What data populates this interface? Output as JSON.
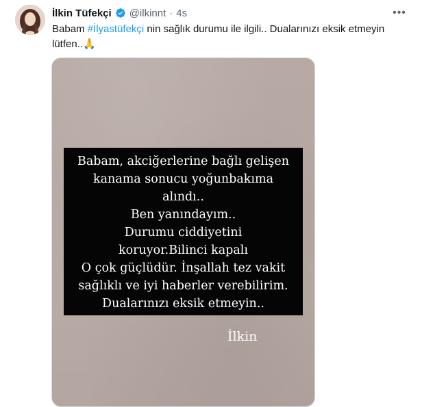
{
  "tweet": {
    "author_name": "İlkin Tüfekçi",
    "handle": "@ilkinnt",
    "separator": "·",
    "time": "4s",
    "more_label": "•••",
    "text_before_hashtag": "Babam ",
    "hashtag": "#İlyastüfekçi",
    "text_after_hashtag": " nin sağlık durumu ile ilgili.. Dualarınızı eksik etmeyin lütfen..🙏"
  },
  "media": {
    "story_lines": [
      "Babam, akciğerlerine bağlı gelişen",
      "kanama sonucu yoğunbakıma",
      "alındı..",
      "Ben yanındayım..",
      "Durumu ciddiyetini",
      "koruyor.Bilinci kapalı",
      "O çok güçlüdür. İnşallah tez vakit",
      "sağlıklı ve iyi haberler verebilirim.",
      "Dualarınızı eksik etmeyin.."
    ],
    "signature": "İlkin"
  },
  "colors": {
    "link": "#1d9bf0",
    "verified": "#1d9bf0",
    "secondary_text": "#536471"
  },
  "icons": {
    "verified": "verified-badge-icon",
    "more": "more-options-icon"
  }
}
